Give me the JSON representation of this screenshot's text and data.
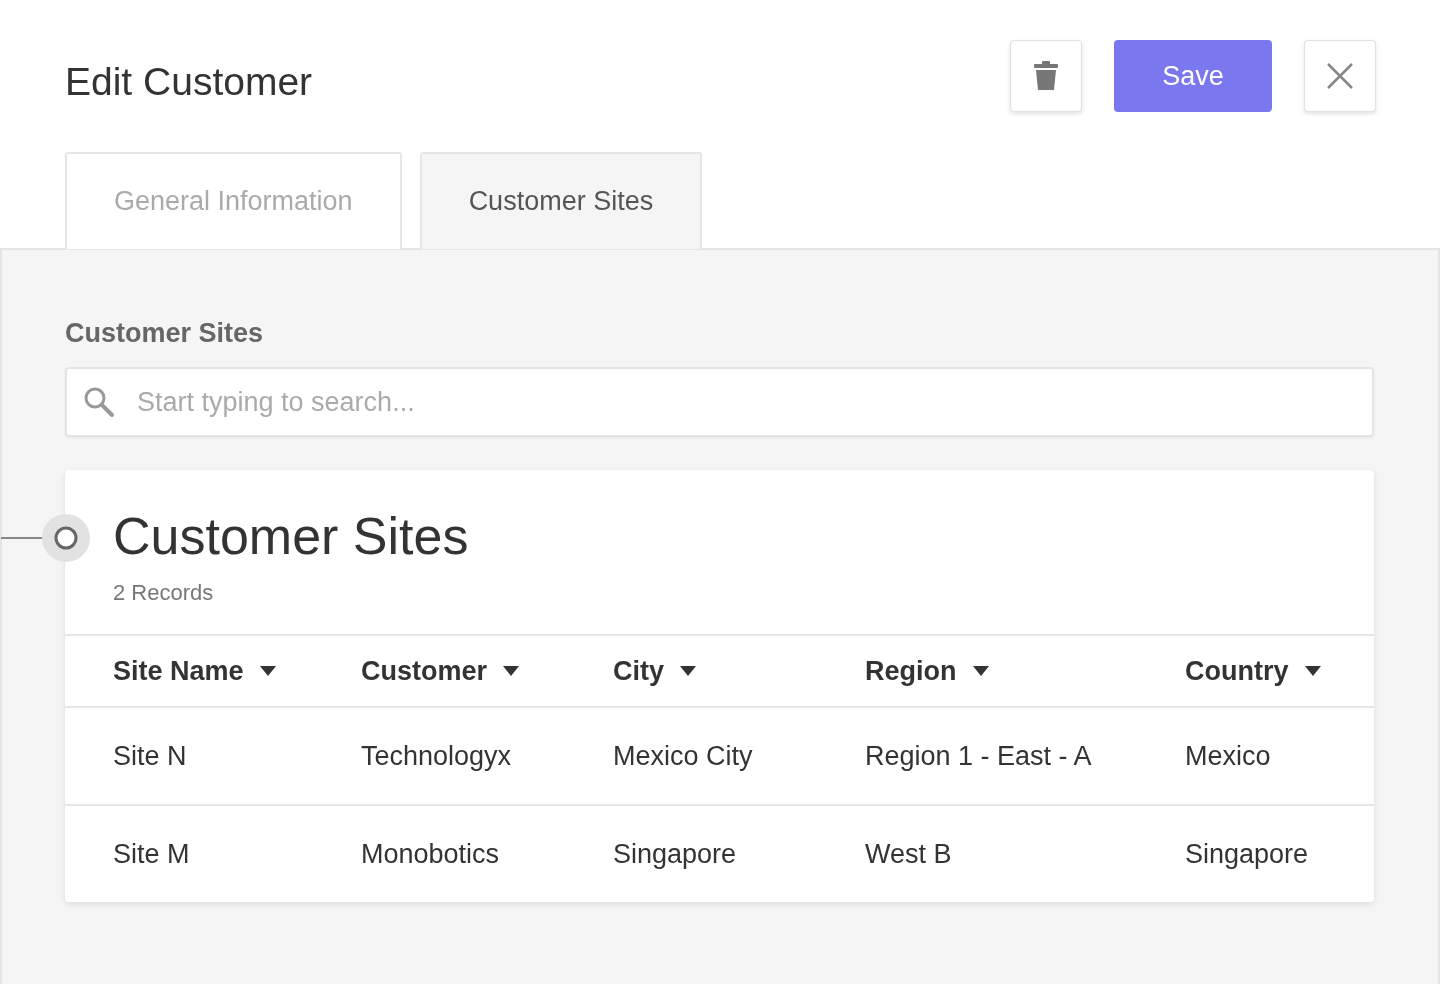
{
  "title": "Edit Customer",
  "actions": {
    "save": "Save"
  },
  "tabs": [
    {
      "label": "General Information",
      "selected": false
    },
    {
      "label": "Customer Sites",
      "selected": true
    }
  ],
  "section_label": "Customer Sites",
  "search": {
    "placeholder": "Start typing to search..."
  },
  "card": {
    "title": "Customer Sites",
    "count": "2 Records"
  },
  "table": {
    "columns": [
      "Site Name",
      "Customer",
      "City",
      "Region",
      "Country"
    ],
    "rows": [
      [
        "Site N",
        "Technologyx",
        "Mexico City",
        "Region 1 - East - A",
        "Mexico"
      ],
      [
        "Site M",
        "Monobotics",
        "Singapore",
        "West B",
        "Singapore"
      ]
    ]
  }
}
